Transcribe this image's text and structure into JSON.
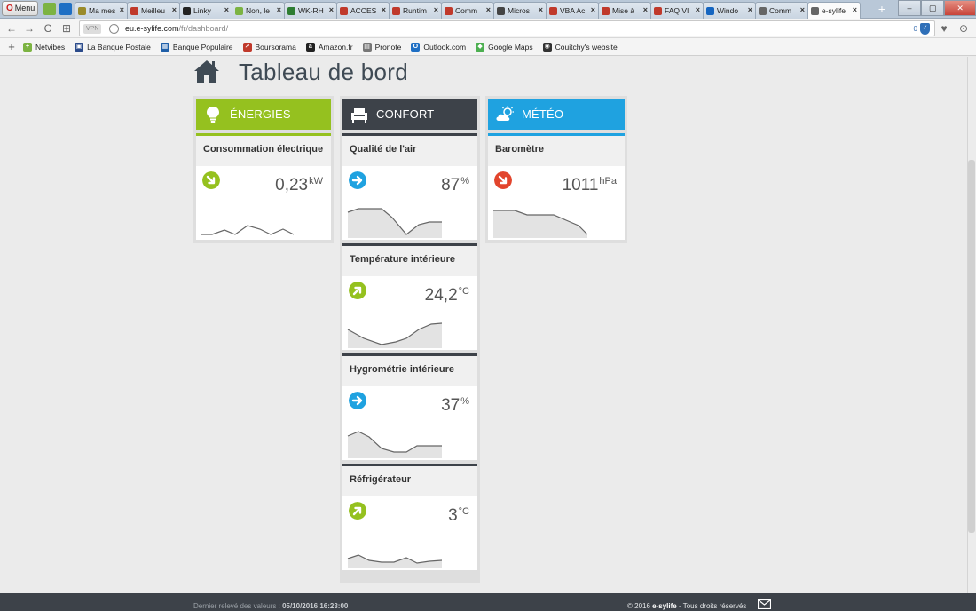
{
  "browser": {
    "menu_label": "Menu",
    "tabs": [
      {
        "label": "Ma mes",
        "color": "#9a8b2a"
      },
      {
        "label": "Meilleu",
        "color": "#c0392b"
      },
      {
        "label": "Linky",
        "color": "#222222"
      },
      {
        "label": "Non, le",
        "color": "#7cb342"
      },
      {
        "label": "WK-RH",
        "color": "#2e7d32"
      },
      {
        "label": "ACCES",
        "color": "#c0392b"
      },
      {
        "label": "Runtim",
        "color": "#c0392b"
      },
      {
        "label": "Comm",
        "color": "#c0392b"
      },
      {
        "label": "Micros",
        "color": "#444444"
      },
      {
        "label": "VBA Ac",
        "color": "#c0392b"
      },
      {
        "label": "Mise à",
        "color": "#c0392b"
      },
      {
        "label": "FAQ VI",
        "color": "#c0392b"
      },
      {
        "label": "Windo",
        "color": "#1565c0"
      },
      {
        "label": "Comm",
        "color": "#666666"
      },
      {
        "label": "e-sylife",
        "color": "#666666"
      }
    ],
    "tab_close": "×",
    "new_tab": "+",
    "url_host": "eu.e-sylife.com",
    "url_path": "/fr/dashboard/",
    "vpn_label": "VPN",
    "shield_count": "0",
    "bookmarks_add": "+",
    "bookmarks": [
      {
        "label": "Netvibes",
        "color": "#7cb342",
        "glyph": "+"
      },
      {
        "label": "La Banque Postale",
        "color": "#2a4a8a",
        "glyph": "▣"
      },
      {
        "label": "Banque Populaire",
        "color": "#1f5fa8",
        "glyph": "▦"
      },
      {
        "label": "Boursorama",
        "color": "#c0392b",
        "glyph": "↗"
      },
      {
        "label": "Amazon.fr",
        "color": "#222222",
        "glyph": "a"
      },
      {
        "label": "Pronote",
        "color": "#777777",
        "glyph": "▤"
      },
      {
        "label": "Outlook.com",
        "color": "#1e6fc4",
        "glyph": "O"
      },
      {
        "label": "Google Maps",
        "color": "#4caf50",
        "glyph": "◆"
      },
      {
        "label": "Couitchy's website",
        "color": "#333333",
        "glyph": "◉"
      }
    ]
  },
  "page": {
    "title": "Tableau de bord"
  },
  "colors": {
    "energies": "#95c11f",
    "confort": "#3d4249",
    "meteo": "#1fa2e0",
    "arrow_green": "#95c11f",
    "arrow_blue": "#1fa2e0",
    "arrow_red": "#e2452d"
  },
  "columns": [
    {
      "name": "ÉNERGIES",
      "icon": "lightbulb-icon",
      "cards": [
        {
          "title": "Consommation électrique",
          "value": "0,23",
          "unit": "kW",
          "trend": "down",
          "trend_icon": "arrow-down-right-icon"
        }
      ]
    },
    {
      "name": "CONFORT",
      "icon": "armchair-icon",
      "cards": [
        {
          "title": "Qualité de l'air",
          "value": "87",
          "unit": "%",
          "trend": "stable",
          "trend_icon": "arrow-right-icon"
        },
        {
          "title": "Température intérieure",
          "value": "24,2",
          "unit": "°C",
          "trend": "up",
          "trend_icon": "arrow-up-right-icon"
        },
        {
          "title": "Hygrométrie intérieure",
          "value": "37",
          "unit": "%",
          "trend": "stable",
          "trend_icon": "arrow-right-icon"
        },
        {
          "title": "Réfrigérateur",
          "value": "3",
          "unit": "°C",
          "trend": "up",
          "trend_icon": "arrow-up-right-icon"
        }
      ]
    },
    {
      "name": "MÉTÉO",
      "icon": "sun-cloud-icon",
      "cards": [
        {
          "title": "Baromètre",
          "value": "1011",
          "unit": "hPa",
          "trend": "down",
          "trend_icon": "arrow-down-right-red-icon"
        }
      ]
    }
  ],
  "footer": {
    "last_reading_label": "Dernier relevé des valeurs :",
    "last_reading_value": "05/10/2016 16:23:00",
    "copyright_prefix": "© 2016",
    "brand": "e-sylife",
    "copyright_suffix": "- Tous droits réservés"
  }
}
